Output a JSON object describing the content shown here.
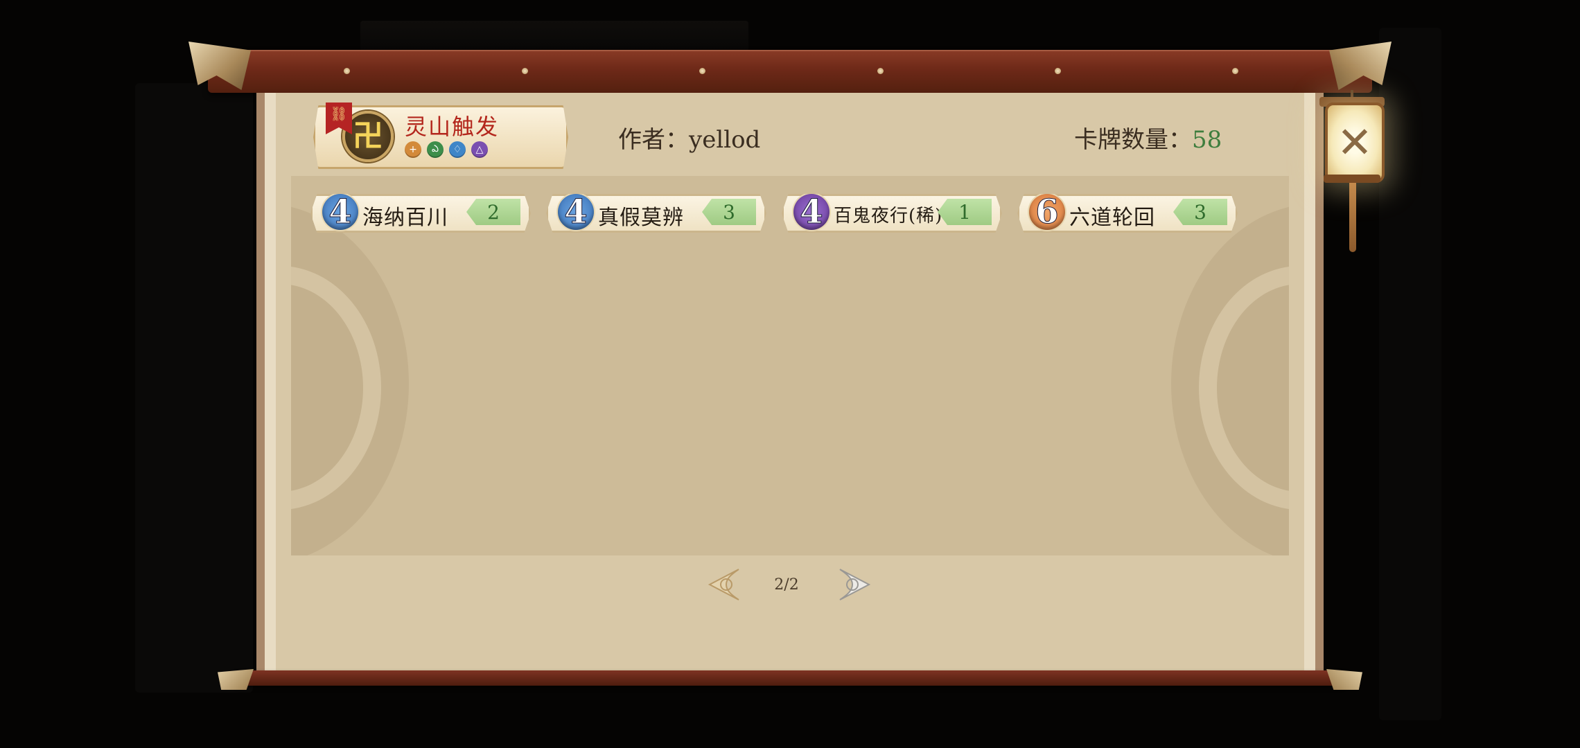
{
  "deck": {
    "name": "灵山触发",
    "emblem": "卍",
    "tag_icon": "⛓",
    "element_icons": [
      {
        "name": "plus",
        "glyph": "+",
        "color": "#d38a3a"
      },
      {
        "name": "leaf",
        "glyph": "ఎ",
        "color": "#3d8e4a"
      },
      {
        "name": "water",
        "glyph": "♢",
        "color": "#3f86c8"
      },
      {
        "name": "mountain",
        "glyph": "△",
        "color": "#7a4fb0"
      }
    ]
  },
  "author_label": "作者：yellod",
  "count_label": "卡牌数量：",
  "count_value": "58",
  "cards": [
    {
      "cost": "4",
      "name": "海纳百川",
      "qty": "2",
      "badge_color": "#3b72b8"
    },
    {
      "cost": "4",
      "name": "真假莫辨",
      "qty": "3",
      "badge_color": "#3b72b8"
    },
    {
      "cost": "4",
      "name": "百鬼夜行(稀)",
      "qty": "1",
      "badge_color": "#6a3b9c"
    },
    {
      "cost": "6",
      "name": "六道轮回",
      "qty": "3",
      "badge_color": "#d9793a"
    }
  ],
  "pagination": {
    "label": "2/2"
  },
  "close_label": "✕"
}
